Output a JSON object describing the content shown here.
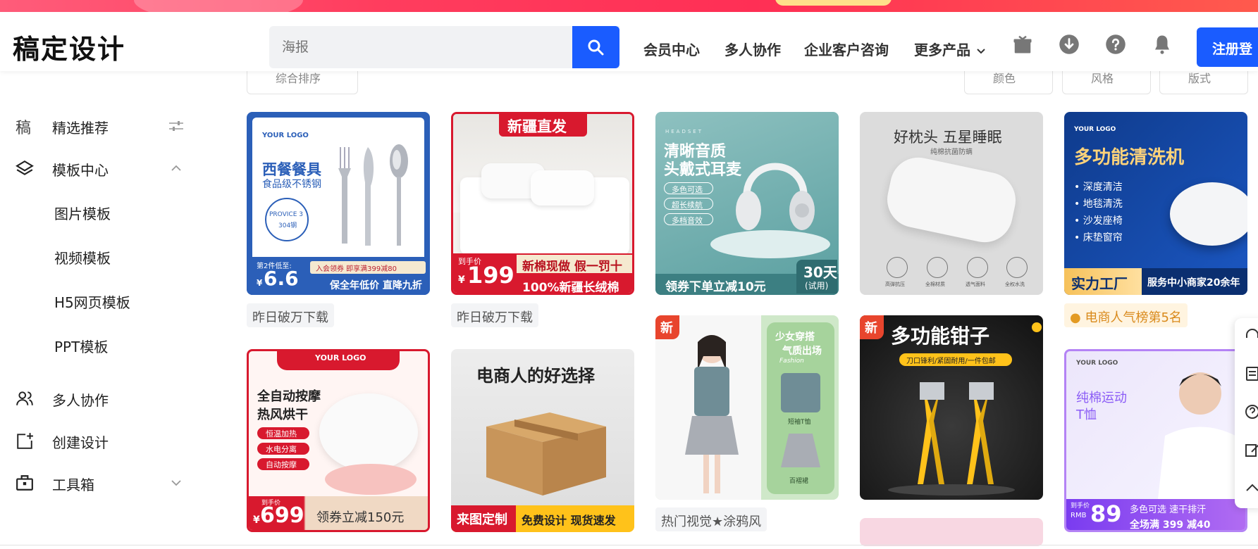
{
  "app": {
    "logo_text": "稿定设计"
  },
  "search": {
    "placeholder": "海报"
  },
  "nav": {
    "items": [
      "会员中心",
      "多人协作",
      "企业客户咨询",
      "更多产品"
    ],
    "register_label": "注册登"
  },
  "filters": [
    "综合排序",
    "颜色",
    "风格",
    "版式"
  ],
  "sidebar": {
    "items": [
      {
        "label": "精选推荐",
        "icon": "gao-icon"
      },
      {
        "label": "模板中心",
        "icon": "layers-icon"
      },
      {
        "label": "图片模板"
      },
      {
        "label": "视频模板"
      },
      {
        "label": "H5网页模板"
      },
      {
        "label": "PPT模板"
      },
      {
        "label": "多人协作",
        "icon": "users-icon"
      },
      {
        "label": "创建设计",
        "icon": "add-design-icon"
      },
      {
        "label": "工具箱",
        "icon": "toolbox-icon"
      }
    ]
  },
  "cards": {
    "c1": {
      "logo": "YOUR LOGO",
      "title": "西餐餐具",
      "sub": "食品级不锈钢",
      "seal": "PROVICE 3",
      "seal2": "304钢",
      "promo_small": "第2件低至:",
      "price_sym": "¥",
      "price": "6.6",
      "coupon": "入会领券 即享满399减80",
      "footer": "保全年低价 直降九折",
      "tag": "昨日破万下载"
    },
    "c2": {
      "banner": "新疆直发",
      "price_label": "到手价",
      "price_sym": "¥",
      "price": "199",
      "line1": "新棉现做 假一罚十",
      "line2": "100%新疆长绒棉",
      "tag": "昨日破万下载"
    },
    "c3": {
      "eyebrow": "HEADSET",
      "title1": "清晰音质",
      "title2": "头戴式耳麦",
      "chips": [
        "多色可选",
        "超长续航",
        "多档音效"
      ],
      "footer": "领券下单立减10元",
      "days": "30天",
      "trial": "(试用)"
    },
    "c4": {
      "title": "好枕头 五星睡眠",
      "sub": "纯棉抗菌防螨",
      "features": [
        "高弹抗压",
        "全棉材质",
        "透气面料",
        "全权水洗"
      ]
    },
    "c5": {
      "logo": "YOUR LOGO",
      "title": "多功能清洗机",
      "bullets": [
        "深度清洁",
        "地毯清洗",
        "沙发座椅",
        "床垫窗帘"
      ],
      "footer1": "实力工厂",
      "footer2": "服务中小商家20余年",
      "tag": "电商人气榜第5名"
    },
    "c6": {
      "logo": "YOUR LOGO",
      "title1": "全自动按摩",
      "title2": "热风烘干",
      "chips": [
        "恒温加热",
        "水电分离",
        "自动按摩"
      ],
      "price_label": "到手价",
      "price_sym": "¥",
      "price": "699",
      "coupon": "领券立减150元"
    },
    "c7": {
      "title": "电商人的好选择",
      "footer1": "来图定制",
      "footer2": "免费设计 现货速发"
    },
    "c8": {
      "new": "新",
      "title1": "少女穿搭",
      "title2": "气质出场",
      "script": "Fashion",
      "label1": "短袖T恤",
      "label2": "百褶裙",
      "tag": "热门视觉★涂鸦风"
    },
    "c9": {
      "new": "新",
      "title": "多功能钳子",
      "sub": "刀口锋利/紧固耐用/一件包邮"
    },
    "c10": {
      "logo": "YOUR LOGO",
      "title1": "纯棉运动",
      "title2": "T恤",
      "price_label": "到手价",
      "rmb": "RMB",
      "price": "89",
      "line1": "多色可选 速干排汗",
      "line2": "全场满 399 减40"
    }
  }
}
